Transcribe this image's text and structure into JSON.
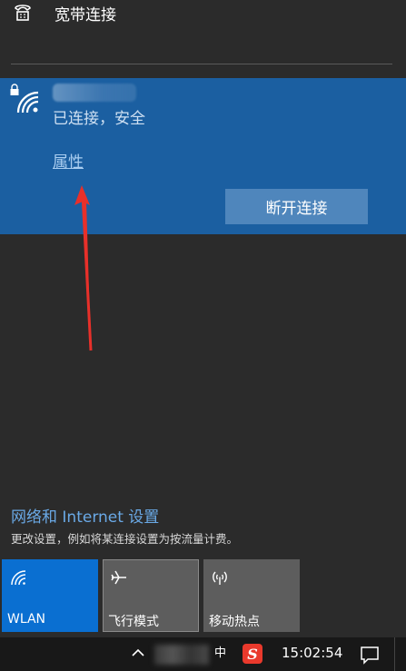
{
  "broadband": {
    "label": "宽带连接",
    "icon": "dialup-phone-icon"
  },
  "wifi": {
    "ssid": "",
    "status": "已连接，安全",
    "properties_link": "属性",
    "disconnect_button": "断开连接",
    "panel_color": "#1b5fa1",
    "icon": "wifi-secure-icon"
  },
  "network_settings": {
    "title": "网络和 Internet 设置",
    "description": "更改设置，例如将某连接设置为按流量计费。"
  },
  "quick_actions": [
    {
      "label": "WLAN",
      "icon": "wifi-icon",
      "active": true
    },
    {
      "label": "飞行模式",
      "icon": "airplane-icon",
      "active": false
    },
    {
      "label": "移动热点",
      "icon": "hotspot-icon",
      "active": false
    }
  ],
  "taskbar": {
    "ime_indicator": "中",
    "sogou_label": "S",
    "time": "15:02:54"
  },
  "colors": {
    "accent": "#0a6fd1",
    "annotation_arrow": "#e8302a"
  }
}
